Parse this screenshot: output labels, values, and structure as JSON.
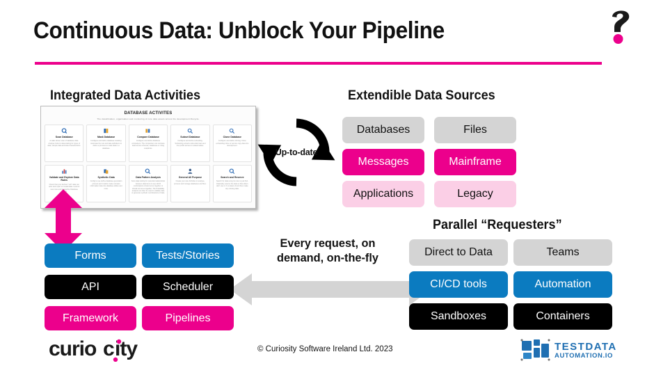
{
  "slide": {
    "title": "Continuous Data: Unblock Your Pipeline",
    "accent_color": "#EC008C",
    "blue_color": "#0B7BC0",
    "gray_color": "#D4D4D4",
    "light_pink_color": "#FBCFE6"
  },
  "headings": {
    "activities": "Integrated Data Activities",
    "sources": "Extendible Data Sources",
    "requesters": "Parallel “Requesters”"
  },
  "cycle": {
    "label": "Up-to-date",
    "icon": "refresh-cycle-icon"
  },
  "middle": {
    "caption_line1": "Every request, on",
    "caption_line2": "demand, on-the-fly",
    "arrow_icon": "double-headed-horizontal-arrow-icon"
  },
  "left_arrow": {
    "icon": "double-headed-vertical-arrow-icon"
  },
  "screenshot": {
    "title": "DATABASE ACTIVITES",
    "subtitle": "The classification, organisation and monitoring of core data assets across the development lifecycle.",
    "cards": [
      {
        "title": "Scan Database",
        "icon": "magnifier-database-icon",
        "desc": "A static driven scan of database data. Analyse Column data looking for types of data, sample data and data characteristics."
      },
      {
        "title": "Mask Database",
        "icon": "mask-database-icon",
        "desc": "Configure and define database masking. Automate the rule and data definitions to define a process to mask data in a database."
      },
      {
        "title": "Compare Database",
        "icon": "compare-columns-icon",
        "desc": "Configure and define database comparison. The comparison can compare data across schemas, databases or using snapshots."
      },
      {
        "title": "Subset Database",
        "icon": "subset-database-icon",
        "desc": "Configure and define subsetting. Subsetting extracts referential rows and true public access to related tables."
      },
      {
        "title": "Clone Database",
        "icon": "clone-database-icon",
        "desc": "Configure and define cloning. Clone embedding clone or service copy data into development."
      },
      {
        "title": "Validate and Explore Data Rules",
        "icon": "bar-chart-rules-icon",
        "desc": "Check that your defined \"soft\" data can refer and report on invalid data. Look for new rules and Categorise Database entities."
      },
      {
        "title": "Synthetic Data",
        "icon": "synthetic-data-icon",
        "desc": "Config to use define database generation process and models create complex information data into database tables and rows."
      },
      {
        "title": "Data Pattern Analysis",
        "icon": "pattern-analysis-icon",
        "desc": "Scan data looking for potential relationships between data items to see which combinations should occur together or should not occur together. The Probability analysis can then be used to validate data or generate synthetic combinations of data."
      },
      {
        "title": "General All Purpose",
        "icon": "person-general-icon",
        "desc": "Create your own Activities to analyse, process and manage databases and files."
      },
      {
        "title": "Search and Reserve",
        "icon": "search-reserve-icon",
        "desc": "Search for data using its rules to just find. Optionally reserve the data so that others don't use it. If no data is found then make any missing data."
      }
    ]
  },
  "data_sources": [
    {
      "label": "Databases",
      "style": "gray"
    },
    {
      "label": "Files",
      "style": "gray"
    },
    {
      "label": "Messages",
      "style": "pink"
    },
    {
      "label": "Mainframe",
      "style": "pink"
    },
    {
      "label": "Applications",
      "style": "lpink"
    },
    {
      "label": "Legacy",
      "style": "lpink"
    }
  ],
  "tools": [
    {
      "label": "Forms",
      "style": "blue"
    },
    {
      "label": "Tests/Stories",
      "style": "blue"
    },
    {
      "label": "API",
      "style": "black"
    },
    {
      "label": "Scheduler",
      "style": "black"
    },
    {
      "label": "Framework",
      "style": "pink"
    },
    {
      "label": "Pipelines",
      "style": "pink"
    }
  ],
  "requesters": [
    {
      "label": "Direct to Data",
      "style": "gray"
    },
    {
      "label": "Teams",
      "style": "gray"
    },
    {
      "label": "CI/CD tools",
      "style": "blue"
    },
    {
      "label": "Automation",
      "style": "blue"
    },
    {
      "label": "Sandboxes",
      "style": "black"
    },
    {
      "label": "Containers",
      "style": "black"
    }
  ],
  "footer": {
    "copyright": "© Curiosity Software Ireland Ltd. 2023",
    "brand_logo": "curiosity-wordmark-logo",
    "partner_logo_line1": "TESTDATA",
    "partner_logo_line2": "AUTOMATION.IO"
  }
}
